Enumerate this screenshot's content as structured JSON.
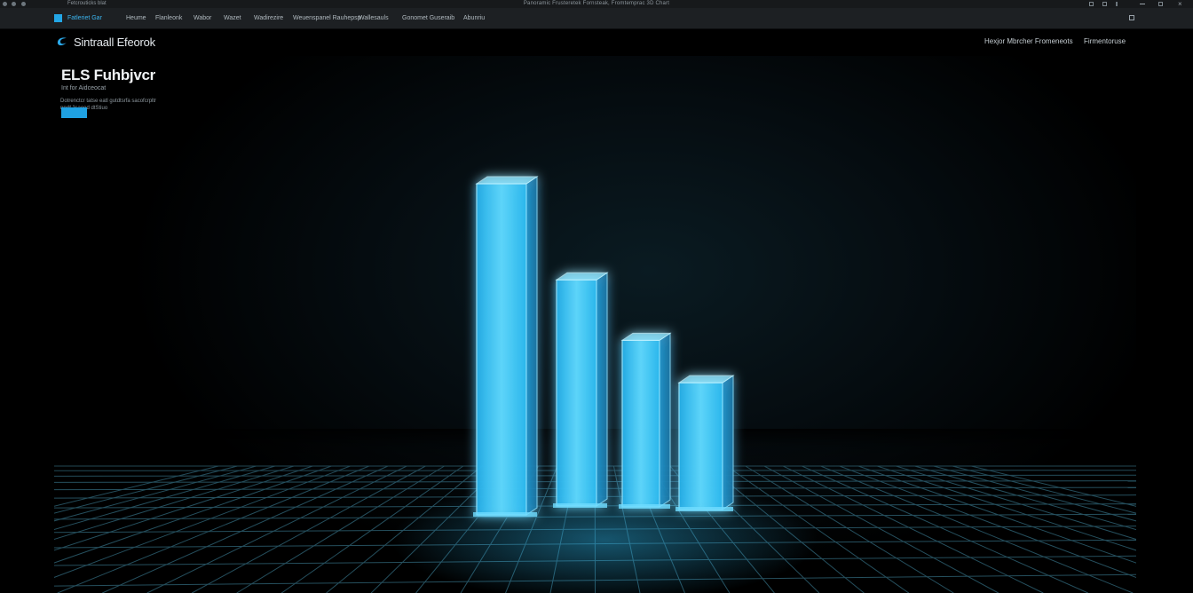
{
  "titlebar": {
    "app_label": "Fetcrouticks blat",
    "title": "Panoramic Frusteretek Fornsteak, Fromtemprac 3D Chart",
    "left_icons": [
      "unidentified-icon",
      "unidentified-icon",
      "unidentified-icon"
    ],
    "right_icons": [
      "tile-icon",
      "tile-icon",
      "more-icon",
      "minimize-icon",
      "maximize-icon",
      "close-icon"
    ]
  },
  "tabs": {
    "active": "Fatleriet Gar",
    "items": [
      "Heume",
      "Flanleonk",
      "Wabor",
      "Wazet",
      "Wadirezire",
      "Weuenspanel Rauhepsp",
      "Wallesauls",
      "Gonomet Guseraib",
      "Abunriu"
    ]
  },
  "nav": {
    "logo_text": "Sintraall Efeorok",
    "links": [
      "Hexjor Mbrcher Fromeneots",
      "Firmentoruse"
    ]
  },
  "hero": {
    "title": "ELS Fuhbjvcr",
    "subtitle": "Int for Aidceocat",
    "description": "Dotrenctcr tatse eatl gutdtsrfa sacofcrpltr nnd* 'lsaeed dtStiuo",
    "cta_label": ""
  },
  "visual": {
    "accent_color": "#23a6e6",
    "bar_color": "#35c6f5",
    "grid_color": "#2a5868",
    "bar_levels": [
      1.0,
      0.683,
      0.503,
      0.383
    ]
  }
}
